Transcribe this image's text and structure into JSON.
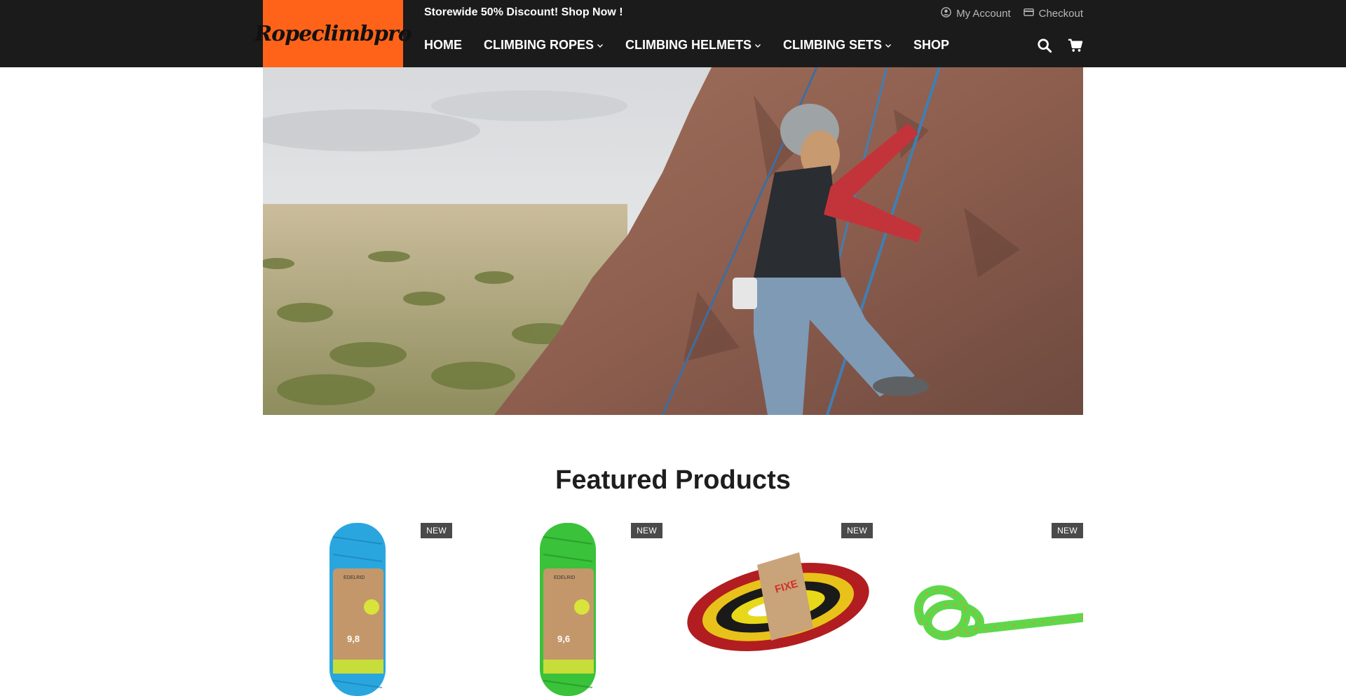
{
  "brand": {
    "logo_text": "Ropeclimbpro",
    "accent": "#ff6319"
  },
  "topbar": {
    "promo": "Storewide 50% Discount! Shop Now !",
    "links": [
      {
        "label": "My Account",
        "icon": "user-icon"
      },
      {
        "label": "Checkout",
        "icon": "credit-card-icon"
      }
    ]
  },
  "nav": {
    "items": [
      {
        "label": "HOME",
        "dropdown": false
      },
      {
        "label": "CLIMBING ROPES",
        "dropdown": true
      },
      {
        "label": "CLIMBING HELMETS",
        "dropdown": true
      },
      {
        "label": "CLIMBING SETS",
        "dropdown": true
      },
      {
        "label": "SHOP",
        "dropdown": false
      }
    ],
    "tools": [
      "search-icon",
      "cart-icon"
    ]
  },
  "featured": {
    "title": "Featured Products",
    "products": [
      {
        "badge": "NEW",
        "rope_color": "#2aa6df",
        "label_text": "9,8",
        "brand_on_label": "EDELRID"
      },
      {
        "badge": "NEW",
        "rope_color": "#39c23a",
        "label_text": "9,6",
        "brand_on_label": "EDELRID"
      },
      {
        "badge": "NEW",
        "rope_color": "#e0b216",
        "label_text": "FIXE"
      },
      {
        "badge": "NEW",
        "rope_color": "#5ed84a"
      }
    ]
  }
}
